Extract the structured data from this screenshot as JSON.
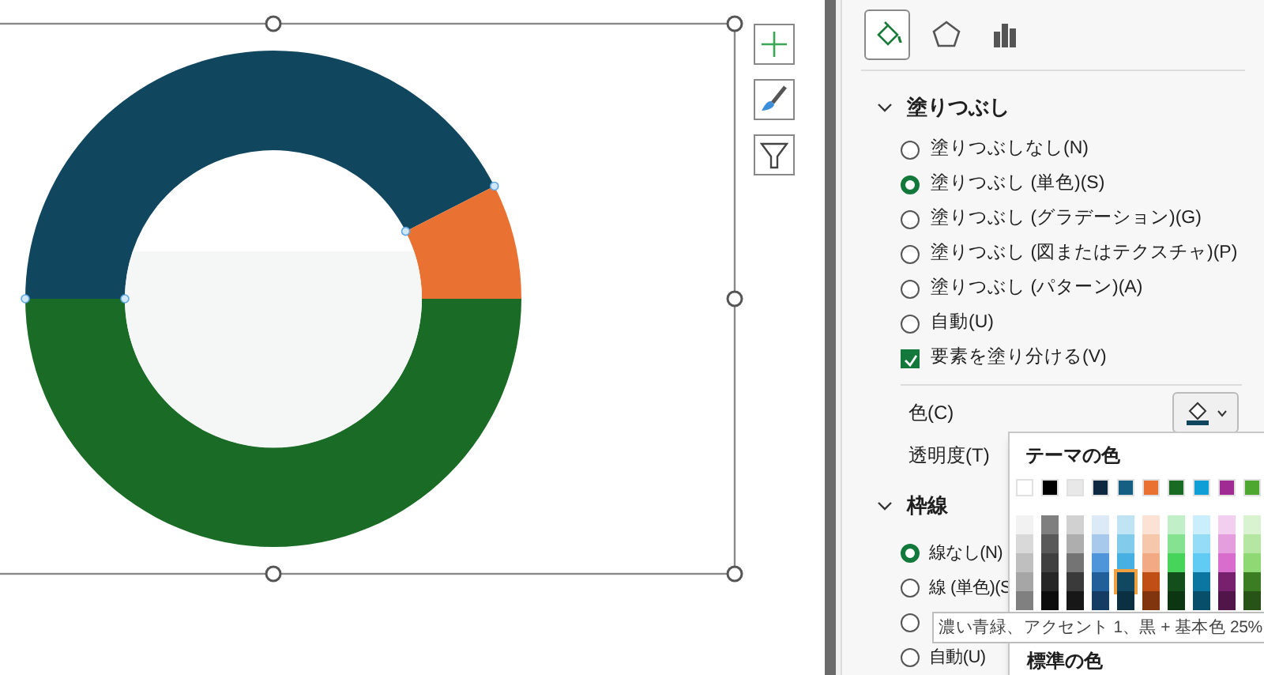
{
  "tabs": [
    {
      "kind": "fill",
      "selected": true
    },
    {
      "kind": "shape",
      "selected": false
    },
    {
      "kind": "bars",
      "selected": false
    }
  ],
  "fill_section": {
    "title": "塗りつぶし",
    "expanded": true,
    "options": [
      {
        "kind": "radio",
        "label": "塗りつぶしなし(N)",
        "selected": false
      },
      {
        "kind": "radio",
        "label": "塗りつぶし (単色)(S)",
        "selected": true
      },
      {
        "kind": "radio",
        "label": "塗りつぶし (グラデーション)(G)",
        "selected": false
      },
      {
        "kind": "radio",
        "label": "塗りつぶし (図またはテクスチャ)(P)",
        "selected": false
      },
      {
        "kind": "radio",
        "label": "塗りつぶし (パターン)(A)",
        "selected": false
      },
      {
        "kind": "radio",
        "label": "自動(U)",
        "selected": false
      },
      {
        "kind": "checkbox",
        "label": "要素を塗り分ける(V)",
        "checked": true
      }
    ],
    "color_label": "色(C)",
    "transparency_label": "透明度(T)"
  },
  "border_section": {
    "title": "枠線",
    "expanded": true,
    "options": [
      {
        "label": "線なし(N)",
        "selected": true
      },
      {
        "label": "線 (単色)(S",
        "selected": false
      },
      {
        "selected": false
      },
      {
        "label": "自動(U)",
        "selected": false
      }
    ]
  },
  "color_picker": {
    "title": "テーマの色",
    "top_row": [
      {
        "color": "#ffffff",
        "selected": false
      },
      {
        "color": "#000000",
        "selected": false
      },
      {
        "color": "#e8e8e8",
        "selected": false
      },
      {
        "color": "#0e2841",
        "selected": false
      },
      {
        "color": "#156082",
        "selected": false
      },
      {
        "color": "#e97132",
        "selected": false
      },
      {
        "color": "#196b24",
        "selected": false
      },
      {
        "color": "#0f9ed5",
        "selected": false
      },
      {
        "color": "#a02b93",
        "selected": false
      },
      {
        "color": "#4ea72e",
        "selected": false
      }
    ],
    "columns": [
      [
        {
          "color": "#f2f2f2",
          "selected": false
        },
        {
          "color": "#d9d9d9",
          "selected": false
        },
        {
          "color": "#bfbfbf",
          "selected": false
        },
        {
          "color": "#a6a6a6",
          "selected": false
        },
        {
          "color": "#808080",
          "selected": false
        }
      ],
      [
        {
          "color": "#7f7f7f",
          "selected": false
        },
        {
          "color": "#595959",
          "selected": false
        },
        {
          "color": "#404040",
          "selected": false
        },
        {
          "color": "#262626",
          "selected": false
        },
        {
          "color": "#0d0d0d",
          "selected": false
        }
      ],
      [
        {
          "color": "#d1d1d1",
          "selected": false
        },
        {
          "color": "#aeaeae",
          "selected": false
        },
        {
          "color": "#747474",
          "selected": false
        },
        {
          "color": "#3a3a3a",
          "selected": false
        },
        {
          "color": "#171717",
          "selected": false
        }
      ],
      [
        {
          "color": "#dceaf7",
          "selected": false
        },
        {
          "color": "#a6c9ec",
          "selected": false
        },
        {
          "color": "#4e95d9",
          "selected": false
        },
        {
          "color": "#215f9a",
          "selected": false
        },
        {
          "color": "#153d64",
          "selected": false
        }
      ],
      [
        {
          "color": "#c1e4f5",
          "selected": false
        },
        {
          "color": "#83cbeb",
          "selected": false
        },
        {
          "color": "#45b0e1",
          "selected": false
        },
        {
          "color": "#104862",
          "selected": true
        },
        {
          "color": "#0b3041",
          "selected": false
        }
      ],
      [
        {
          "color": "#fbe2d5",
          "selected": false
        },
        {
          "color": "#f7c7ac",
          "selected": false
        },
        {
          "color": "#f2aa84",
          "selected": false
        },
        {
          "color": "#c04f15",
          "selected": false
        },
        {
          "color": "#80350e",
          "selected": false
        }
      ],
      [
        {
          "color": "#c1f0c8",
          "selected": false
        },
        {
          "color": "#84e291",
          "selected": false
        },
        {
          "color": "#47d45a",
          "selected": false
        },
        {
          "color": "#124f1b",
          "selected": false
        },
        {
          "color": "#0c3512",
          "selected": false
        }
      ],
      [
        {
          "color": "#caeefb",
          "selected": false
        },
        {
          "color": "#95dcf7",
          "selected": false
        },
        {
          "color": "#61cbf3",
          "selected": false
        },
        {
          "color": "#0b76a0",
          "selected": false
        },
        {
          "color": "#074f69",
          "selected": false
        }
      ],
      [
        {
          "color": "#f2cfee",
          "selected": false
        },
        {
          "color": "#e59edd",
          "selected": false
        },
        {
          "color": "#d86dcd",
          "selected": false
        },
        {
          "color": "#77206d",
          "selected": false
        },
        {
          "color": "#501549",
          "selected": false
        }
      ],
      [
        {
          "color": "#d9f2d0",
          "selected": false
        },
        {
          "color": "#b5e6a2",
          "selected": false
        },
        {
          "color": "#8ed973",
          "selected": false
        },
        {
          "color": "#3a7d22",
          "selected": false
        },
        {
          "color": "#275317",
          "selected": false
        }
      ]
    ],
    "standard_title": "標準の色"
  },
  "tooltip": "濃い青緑、アクセント 1、黒 + 基本色 25%"
}
